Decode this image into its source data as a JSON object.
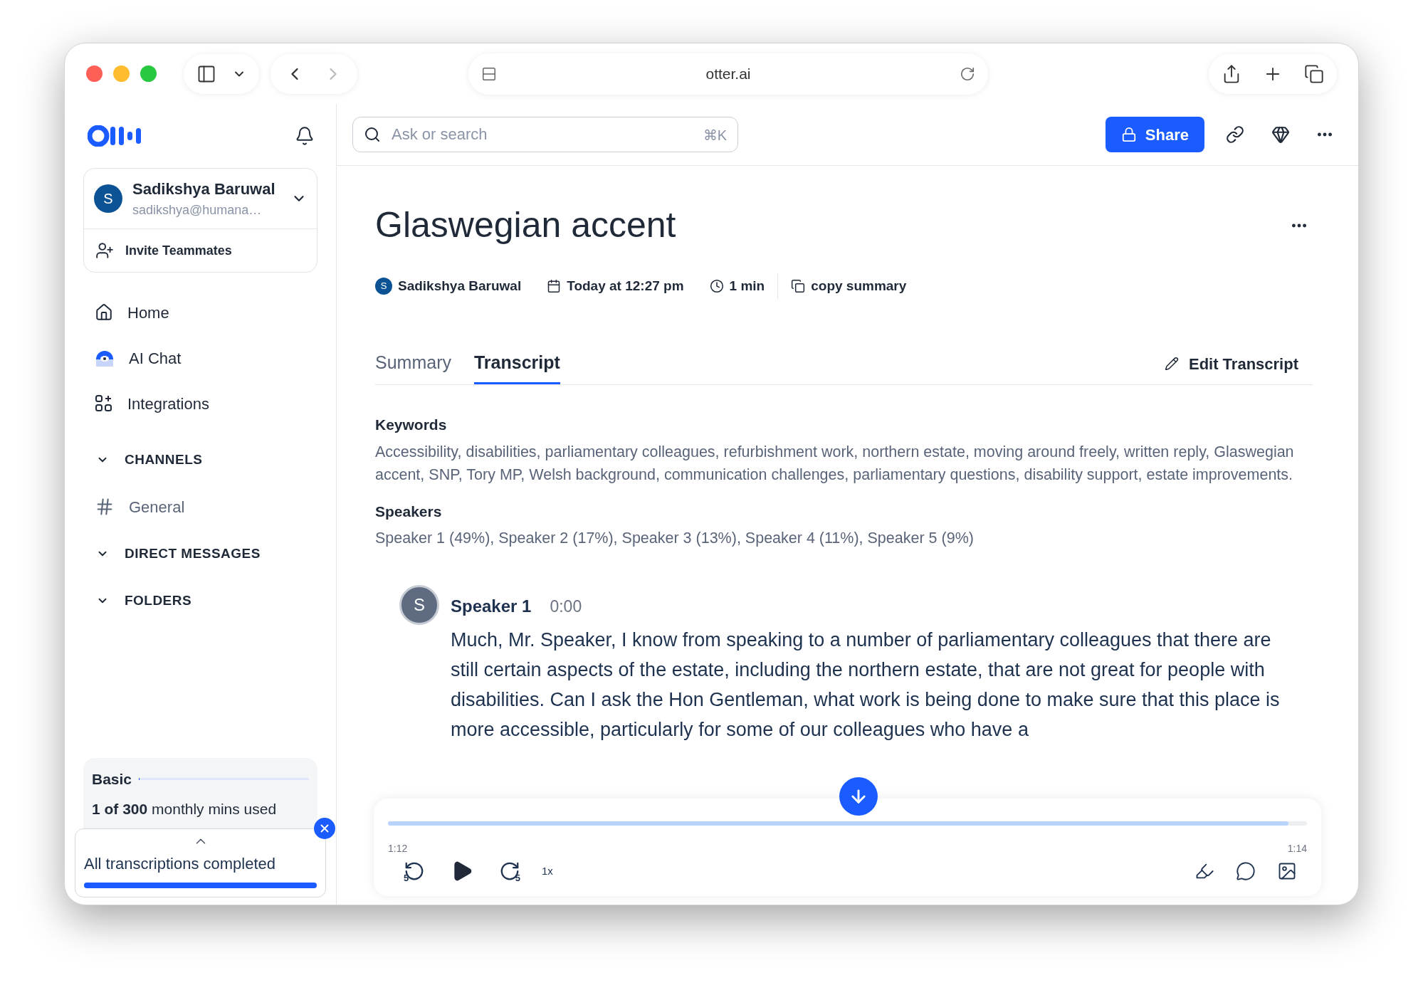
{
  "browser": {
    "url": "otter.ai"
  },
  "sidebar": {
    "user": {
      "initial": "S",
      "name": "Sadikshya Baruwal",
      "email": "sadikshya@humana…"
    },
    "invite": "Invite Teammates",
    "nav": [
      {
        "label": "Home",
        "kind": "home"
      },
      {
        "label": "AI Chat",
        "kind": "chat"
      },
      {
        "label": "Integrations",
        "kind": "integrations"
      }
    ],
    "sections": [
      {
        "label": "CHANNELS",
        "expanded": true,
        "items": [
          {
            "label": "General"
          }
        ]
      },
      {
        "label": "DIRECT MESSAGES",
        "expanded": true
      },
      {
        "label": "FOLDERS",
        "expanded": true
      }
    ],
    "plan": {
      "name": "Basic",
      "level": 0.004,
      "usage": "**1 of 300** monthly mins used"
    },
    "toast": {
      "message": "All transcriptions completed",
      "level": 1
    }
  },
  "search": {
    "placeholder": "Ask or search",
    "shortcut": "⌘K"
  },
  "share_button": "Share",
  "note": {
    "title": "Glaswegian accent",
    "owner": {
      "initial": "S",
      "name": "Sadikshya Baruwal"
    },
    "date": "Today at 12:27 pm",
    "duration": "1 min",
    "copy": "copy summary"
  },
  "tabs": [
    {
      "label": "Summary",
      "selected": false
    },
    {
      "label": "Transcript",
      "selected": true
    }
  ],
  "edit": "Edit Transcript",
  "keywords": {
    "heading": "Keywords",
    "text": "Accessibility, disabilities, parliamentary colleagues, refurbishment work, northern estate, moving around freely, written reply, Glaswegian accent, SNP, Tory MP, Welsh background, communication challenges, parliamentary questions, disability support, estate improvements."
  },
  "speakers": {
    "heading": "Speakers",
    "text": "Speaker 1 (49%), Speaker 2 (17%), Speaker 3 (13%), Speaker 4 (11%), Speaker 5 (9%)"
  },
  "transcript": [
    {
      "initial": "S",
      "speaker": "Speaker 1",
      "time": "0:00",
      "text": "Much, Mr. Speaker, I know from speaking to a number of parliamentary colleagues that there are still certain aspects of the estate, including the northern estate, that are not great for people with disabilities. Can I ask the Hon Gentleman, what work is being done to make sure that this place is more accessible, particularly for some of our colleagues who have a"
    }
  ],
  "player": {
    "level": 0.98,
    "elapsed": "1:12",
    "total": "1:14",
    "rewind": "5",
    "forward": "5",
    "speed": "1x"
  }
}
